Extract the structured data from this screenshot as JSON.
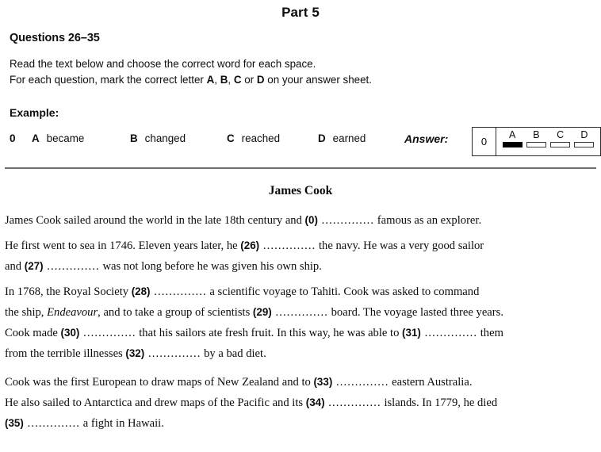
{
  "header": {
    "part_title": "Part 5",
    "questions_range": "Questions 26–35",
    "instruction_line_1_a": "Read the text below and choose the correct word for each space.",
    "instruction_line_2_a": "For each question, mark the correct letter ",
    "instruction_line_2_b": "A",
    "instruction_line_2_c": ", ",
    "instruction_line_2_d": "B",
    "instruction_line_2_e": ", ",
    "instruction_line_2_f": "C",
    "instruction_line_2_g": " or ",
    "instruction_line_2_h": "D",
    "instruction_line_2_i": " on your answer sheet."
  },
  "example": {
    "label": "Example:",
    "question_number": "0",
    "options": [
      {
        "letter": "A",
        "word": "became"
      },
      {
        "letter": "B",
        "word": "changed"
      },
      {
        "letter": "C",
        "word": "reached"
      },
      {
        "letter": "D",
        "word": "earned"
      }
    ],
    "answer_label": "Answer:",
    "answer_box": {
      "question_number": "0",
      "choices": [
        {
          "letter": "A",
          "marked": true
        },
        {
          "letter": "B",
          "marked": false
        },
        {
          "letter": "C",
          "marked": false
        },
        {
          "letter": "D",
          "marked": false
        }
      ]
    }
  },
  "passage": {
    "title": "James Cook",
    "gap_dots": "..............",
    "paragraphs": [
      {
        "id": "p1",
        "lines": [
          [
            {
              "t": "text",
              "v": "James Cook sailed around the world in the late 18th century and "
            },
            {
              "t": "qnum",
              "v": "(0)"
            },
            {
              "t": "gap"
            },
            {
              "t": "text",
              "v": " famous as an explorer."
            }
          ]
        ]
      },
      {
        "id": "p2",
        "lines": [
          [
            {
              "t": "text",
              "v": "He first went to sea in 1746.  Eleven years later, he "
            },
            {
              "t": "qnum",
              "v": "(26)"
            },
            {
              "t": "gap"
            },
            {
              "t": "text",
              "v": " the navy.  He was a very good sailor"
            }
          ],
          [
            {
              "t": "text",
              "v": "and "
            },
            {
              "t": "qnum",
              "v": "(27)"
            },
            {
              "t": "gap"
            },
            {
              "t": "text",
              "v": " was not long before he was given his own ship."
            }
          ]
        ]
      },
      {
        "id": "p3",
        "lines": [
          [
            {
              "t": "text",
              "v": "In 1768, the Royal Society "
            },
            {
              "t": "qnum",
              "v": "(28)"
            },
            {
              "t": "gap"
            },
            {
              "t": "text",
              "v": " a scientific voyage to Tahiti.  Cook was asked to command"
            }
          ],
          [
            {
              "t": "text",
              "v": "the ship, "
            },
            {
              "t": "italic",
              "v": "Endeavour"
            },
            {
              "t": "text",
              "v": ", and to take a group of scientists "
            },
            {
              "t": "qnum",
              "v": "(29)"
            },
            {
              "t": "gap"
            },
            {
              "t": "text",
              "v": " board.  The voyage lasted three years."
            }
          ],
          [
            {
              "t": "text",
              "v": "Cook made "
            },
            {
              "t": "qnum",
              "v": "(30)"
            },
            {
              "t": "gap"
            },
            {
              "t": "text",
              "v": " that his sailors ate fresh fruit.  In this way, he was able to "
            },
            {
              "t": "qnum",
              "v": "(31)"
            },
            {
              "t": "gap"
            },
            {
              "t": "text",
              "v": " them"
            }
          ],
          [
            {
              "t": "text",
              "v": "from the terrible illnesses "
            },
            {
              "t": "qnum",
              "v": "(32)"
            },
            {
              "t": "gap"
            },
            {
              "t": "text",
              "v": " by a bad diet."
            }
          ]
        ]
      },
      {
        "id": "p4",
        "lines": [
          [
            {
              "t": "text",
              "v": "Cook was the first European to draw maps of New Zealand and to "
            },
            {
              "t": "qnum",
              "v": "(33)"
            },
            {
              "t": "gap"
            },
            {
              "t": "text",
              "v": " eastern Australia."
            }
          ],
          [
            {
              "t": "text",
              "v": "He also sailed to Antarctica and drew maps of the Pacific and its "
            },
            {
              "t": "qnum",
              "v": "(34)"
            },
            {
              "t": "gap"
            },
            {
              "t": "text",
              "v": "  islands.  In 1779, he died"
            }
          ],
          [
            {
              "t": "qnum",
              "v": "(35)"
            },
            {
              "t": "gap"
            },
            {
              "t": "text",
              "v": " a fight in Hawaii."
            }
          ]
        ]
      }
    ]
  },
  "colors": {
    "text": "#0d0d0d",
    "rule": "#6e6e6e",
    "box_border": "#2b2b2b",
    "marked_fill": "#000000"
  }
}
